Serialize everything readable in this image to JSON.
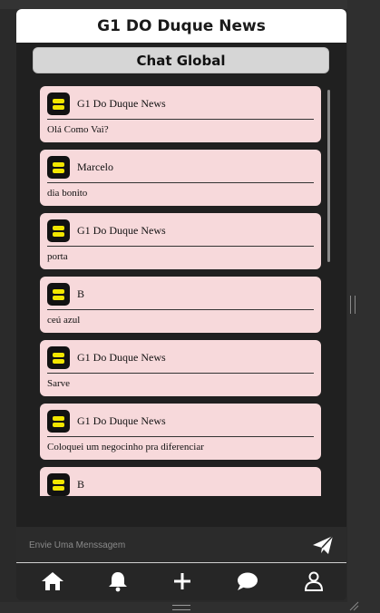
{
  "header": {
    "title": "G1 DO Duque News"
  },
  "chat": {
    "title": "Chat Global",
    "messages": [
      {
        "author": "G1 Do Duque News",
        "text": "Olá Como Vai?"
      },
      {
        "author": "Marcelo",
        "text": "dia bonito"
      },
      {
        "author": "G1 Do Duque News",
        "text": "porta"
      },
      {
        "author": "B",
        "text": "ceú azul"
      },
      {
        "author": "G1 Do Duque News",
        "text": "Sarve"
      },
      {
        "author": "G1 Do Duque News",
        "text": "Coloquei um negocinho pra diferenciar"
      },
      {
        "author": "B",
        "text": ""
      }
    ]
  },
  "composer": {
    "placeholder": "Envie Uma Menssagem",
    "value": ""
  },
  "nav": {
    "items": [
      {
        "icon": "home-icon"
      },
      {
        "icon": "bell-icon"
      },
      {
        "icon": "plus-icon"
      },
      {
        "icon": "chat-bubble-icon"
      },
      {
        "icon": "user-icon"
      }
    ]
  },
  "colors": {
    "card": "#f7d9db",
    "avatar_bg": "#121212",
    "avatar_accent": "#f2e600",
    "background": "#202020",
    "header": "#ffffff"
  }
}
